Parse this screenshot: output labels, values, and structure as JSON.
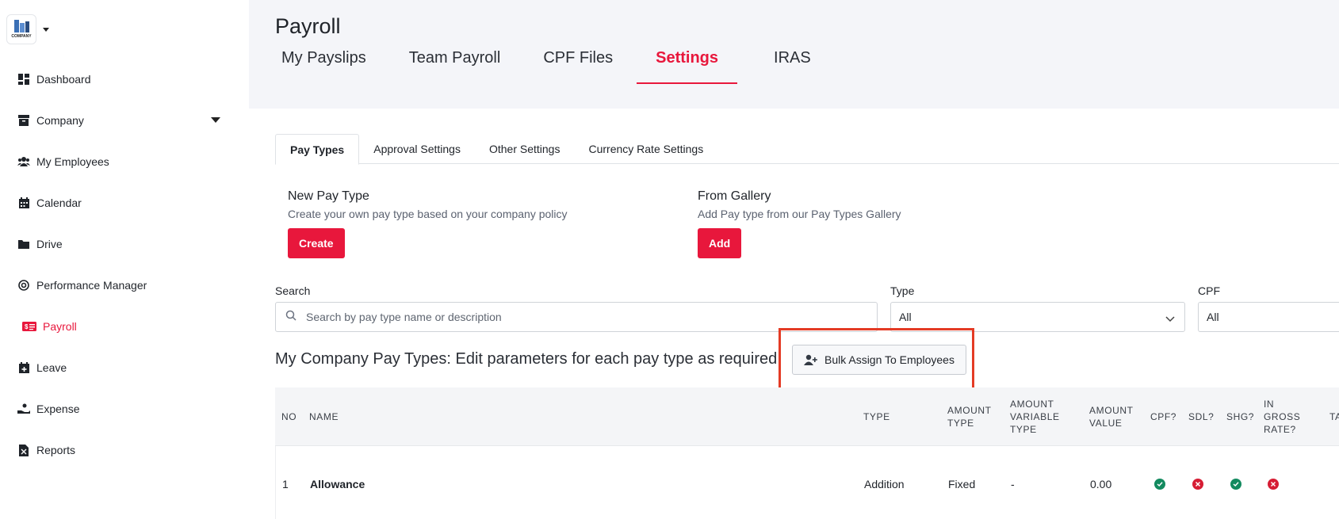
{
  "sidebar": {
    "logo_text": "COMPANY",
    "items": [
      {
        "label": "Dashboard",
        "icon": "dashboard-icon"
      },
      {
        "label": "Company",
        "icon": "archive-icon"
      },
      {
        "label": "My Employees",
        "icon": "users-icon"
      },
      {
        "label": "Calendar",
        "icon": "calendar-icon"
      },
      {
        "label": "Drive",
        "icon": "folder-icon"
      },
      {
        "label": "Performance Manager",
        "icon": "target-icon"
      },
      {
        "label": "Payroll",
        "icon": "money-icon"
      },
      {
        "label": "Leave",
        "icon": "calendar-plus-icon"
      },
      {
        "label": "Expense",
        "icon": "hand-coin-icon"
      },
      {
        "label": "Reports",
        "icon": "excel-file-icon"
      }
    ],
    "active": "Payroll"
  },
  "header": {
    "title": "Payroll",
    "tabs": [
      "My Payslips",
      "Team Payroll",
      "CPF Files",
      "Settings",
      "IRAS"
    ],
    "active_tab": "Settings"
  },
  "subtabs": {
    "items": [
      "Pay Types",
      "Approval Settings",
      "Other Settings",
      "Currency Rate Settings"
    ],
    "active": "Pay Types"
  },
  "new_pay_type": {
    "title": "New Pay Type",
    "description": "Create your own pay type based on your company policy",
    "button": "Create"
  },
  "from_gallery": {
    "title": "From Gallery",
    "description": "Add Pay type from our Pay Types Gallery",
    "button": "Add"
  },
  "filters": {
    "search_label": "Search",
    "search_placeholder": "Search by pay type name or description",
    "type_label": "Type",
    "type_value": "All",
    "cpf_label": "CPF",
    "cpf_value": "All"
  },
  "section": {
    "title": "My Company Pay Types: Edit parameters for each pay type as required.",
    "bulk_button": "Bulk Assign To Employees"
  },
  "table": {
    "headers": {
      "no": "NO",
      "name": "NAME",
      "type": "TYPE",
      "amount_type_1": "AMOUNT",
      "amount_type_2": "TYPE",
      "amount_variable_1": "AMOUNT",
      "amount_variable_2": "VARIABLE",
      "amount_variable_3": "TYPE",
      "amount_value_1": "AMOUNT",
      "amount_value_2": "VALUE",
      "cpf": "CPF?",
      "sdl": "SDL?",
      "shg": "SHG?",
      "gross_1": "IN",
      "gross_2": "GROSS",
      "gross_3": "RATE?",
      "partial": "TA"
    },
    "rows": [
      {
        "no": "1",
        "name": "Allowance",
        "type": "Addition",
        "amount_type": "Fixed",
        "amount_variable_type": "-",
        "amount_value": "0.00",
        "cpf": "yes",
        "sdl": "no",
        "shg": "yes",
        "in_gross_rate": "no"
      }
    ]
  },
  "colors": {
    "accent": "#e8173c",
    "yes": "#138a5f",
    "no": "#d61d34",
    "highlight_box": "#e43b25"
  }
}
